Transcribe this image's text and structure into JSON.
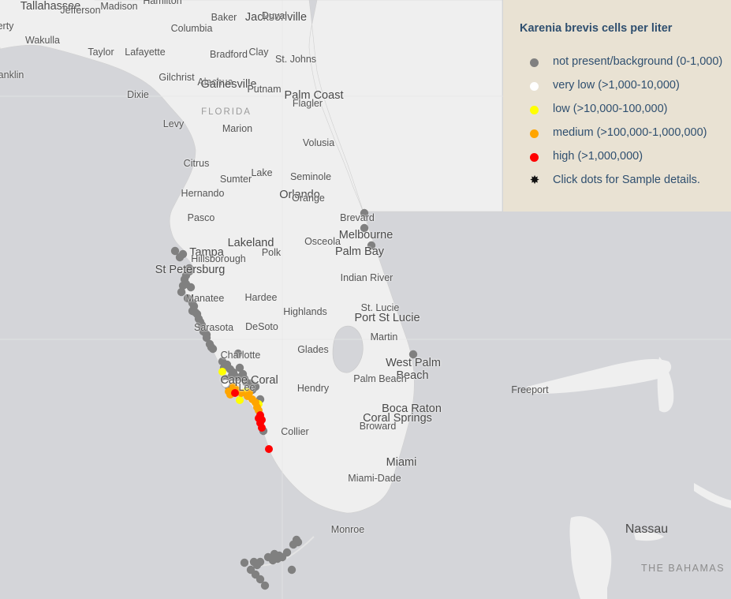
{
  "legend": {
    "title": "Karenia brevis cells per liter",
    "items": [
      {
        "label": "not present/background (0-1,000)",
        "color": "#808080"
      },
      {
        "label": "very low (>1,000-10,000)",
        "color": "#ffffff"
      },
      {
        "label": "low (>10,000-100,000)",
        "color": "#ffff00"
      },
      {
        "label": "medium (>100,000-1,000,000)",
        "color": "#ffa500"
      },
      {
        "label": "high (>1,000,000)",
        "color": "#ff0000"
      }
    ],
    "hint": "Click dots for Sample details.",
    "hint_icon": "asterisk-icon"
  },
  "labels": [
    {
      "text": "Tallahassee",
      "cls": "city"
    },
    {
      "text": "Jefferson",
      "cls": ""
    },
    {
      "text": "Madison",
      "cls": ""
    },
    {
      "text": "Hamilton",
      "cls": ""
    },
    {
      "text": "Baker",
      "cls": ""
    },
    {
      "text": "Jacksonville",
      "cls": "city"
    },
    {
      "text": "Duval",
      "cls": ""
    },
    {
      "text": "erty",
      "cls": ""
    },
    {
      "text": "Columbia",
      "cls": ""
    },
    {
      "text": "Wakulla",
      "cls": ""
    },
    {
      "text": "Taylor",
      "cls": ""
    },
    {
      "text": "Lafayette",
      "cls": ""
    },
    {
      "text": "Bradford",
      "cls": ""
    },
    {
      "text": "Clay",
      "cls": ""
    },
    {
      "text": "St. Johns",
      "cls": ""
    },
    {
      "text": "anklin",
      "cls": ""
    },
    {
      "text": "Gilchrist",
      "cls": ""
    },
    {
      "text": "Alachua",
      "cls": ""
    },
    {
      "text": "Gainesville",
      "cls": "city"
    },
    {
      "text": "Putnam",
      "cls": ""
    },
    {
      "text": "Palm Coast",
      "cls": "city"
    },
    {
      "text": "Dixie",
      "cls": ""
    },
    {
      "text": "Flagler",
      "cls": ""
    },
    {
      "text": "FLORIDA",
      "cls": "region"
    },
    {
      "text": "Levy",
      "cls": ""
    },
    {
      "text": "Marion",
      "cls": ""
    },
    {
      "text": "Volusia",
      "cls": ""
    },
    {
      "text": "Citrus",
      "cls": ""
    },
    {
      "text": "Sumter",
      "cls": ""
    },
    {
      "text": "Lake",
      "cls": ""
    },
    {
      "text": "Seminole",
      "cls": ""
    },
    {
      "text": "Hernando",
      "cls": ""
    },
    {
      "text": "Orlando",
      "cls": "city"
    },
    {
      "text": "Orange",
      "cls": ""
    },
    {
      "text": "Pasco",
      "cls": ""
    },
    {
      "text": "Brevard",
      "cls": ""
    },
    {
      "text": "Melbourne",
      "cls": "city"
    },
    {
      "text": "Lakeland",
      "cls": "city"
    },
    {
      "text": "Osceola",
      "cls": ""
    },
    {
      "text": "Tampa",
      "cls": "city"
    },
    {
      "text": "Polk",
      "cls": ""
    },
    {
      "text": "Palm Bay",
      "cls": "city"
    },
    {
      "text": "Hillsborough",
      "cls": ""
    },
    {
      "text": "St Petersburg",
      "cls": "city"
    },
    {
      "text": "Indian River",
      "cls": ""
    },
    {
      "text": "Manatee",
      "cls": ""
    },
    {
      "text": "Hardee",
      "cls": ""
    },
    {
      "text": "St. Lucie",
      "cls": ""
    },
    {
      "text": "Highlands",
      "cls": ""
    },
    {
      "text": "Port St Lucie",
      "cls": "city"
    },
    {
      "text": "Sarasota",
      "cls": ""
    },
    {
      "text": "DeSoto",
      "cls": ""
    },
    {
      "text": "Martin",
      "cls": ""
    },
    {
      "text": "Glades",
      "cls": ""
    },
    {
      "text": "Charlotte",
      "cls": ""
    },
    {
      "text": "West Palm",
      "cls": "city"
    },
    {
      "text": "Beach",
      "cls": "city"
    },
    {
      "text": "Palm Beach",
      "cls": ""
    },
    {
      "text": "Cape Coral",
      "cls": "city"
    },
    {
      "text": "Lee",
      "cls": ""
    },
    {
      "text": "Hendry",
      "cls": ""
    },
    {
      "text": "Freeport",
      "cls": "sea"
    },
    {
      "text": "Boca Raton",
      "cls": "city"
    },
    {
      "text": "Coral Springs",
      "cls": "city"
    },
    {
      "text": "Broward",
      "cls": ""
    },
    {
      "text": "Collier",
      "cls": ""
    },
    {
      "text": "Miami",
      "cls": "city"
    },
    {
      "text": "Miami-Dade",
      "cls": ""
    },
    {
      "text": "Monroe",
      "cls": ""
    },
    {
      "text": "Nassau",
      "cls": "nassau"
    },
    {
      "text": "THE BAHAMAS",
      "cls": "region2"
    }
  ],
  "samples": [
    {
      "level": 0,
      "n": 68
    },
    {
      "level": 1,
      "n": 1
    },
    {
      "level": 2,
      "n": 4
    },
    {
      "level": 3,
      "n": 12
    },
    {
      "level": 4,
      "n": 7
    }
  ]
}
